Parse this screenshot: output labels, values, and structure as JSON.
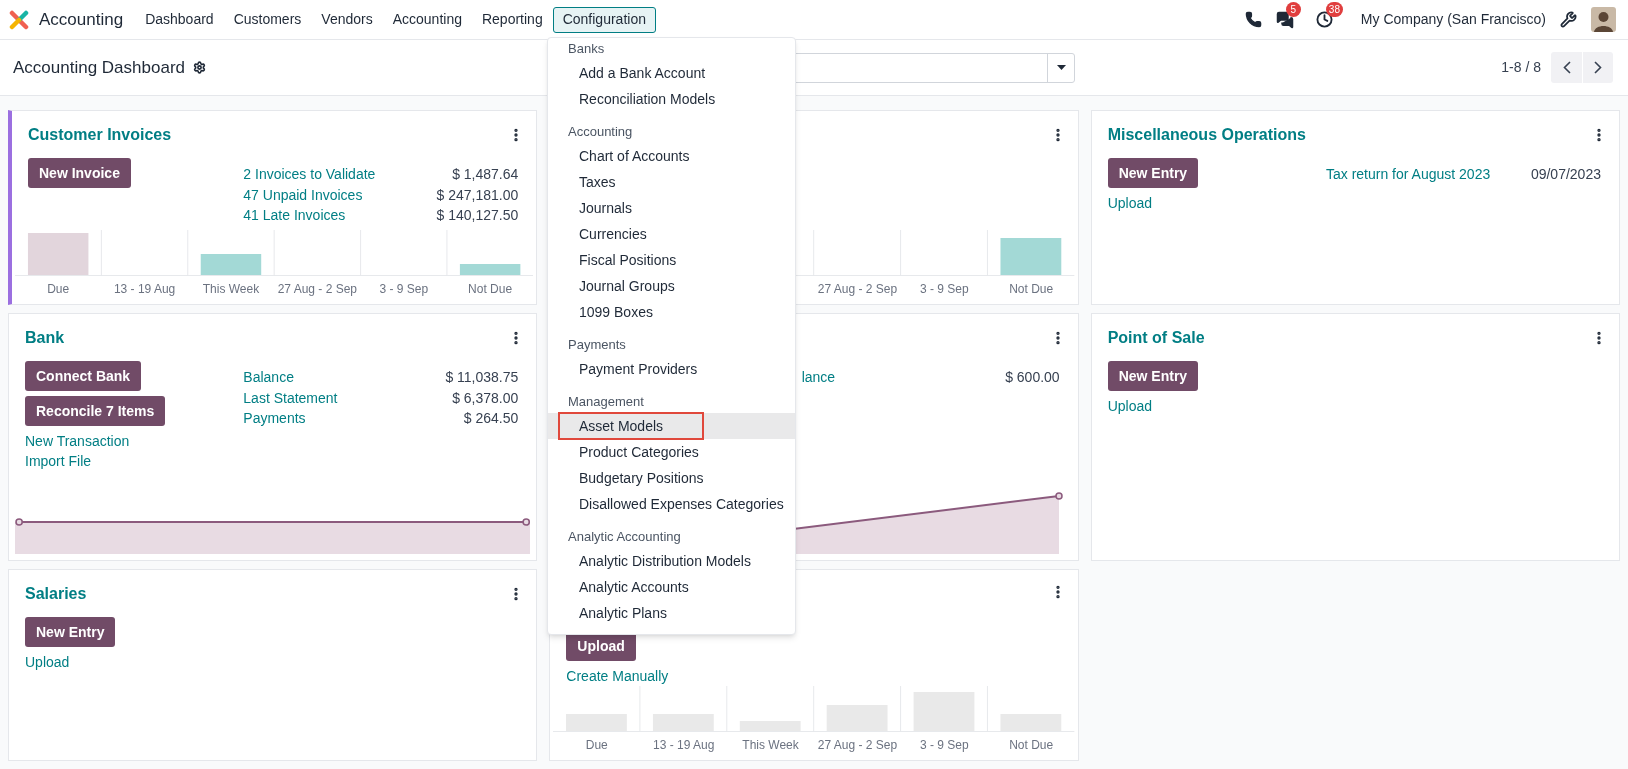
{
  "navbar": {
    "app_name": "Accounting",
    "menus": [
      {
        "label": "Dashboard",
        "selected": false
      },
      {
        "label": "Customers",
        "selected": false
      },
      {
        "label": "Vendors",
        "selected": false
      },
      {
        "label": "Accounting",
        "selected": false
      },
      {
        "label": "Reporting",
        "selected": false
      },
      {
        "label": "Configuration",
        "selected": true
      }
    ]
  },
  "systray": {
    "messages_badge": "5",
    "activities_badge": "38",
    "company": "My Company (San Francisco)"
  },
  "control_panel": {
    "title": "Accounting Dashboard",
    "pager": "1-8 / 8"
  },
  "configuration_menu": {
    "sections": [
      {
        "header": "Banks",
        "items": [
          {
            "label": "Add a Bank Account",
            "selected": false
          },
          {
            "label": "Reconciliation Models",
            "selected": false
          }
        ]
      },
      {
        "header": "Accounting",
        "items": [
          {
            "label": "Chart of Accounts",
            "selected": false
          },
          {
            "label": "Taxes",
            "selected": false
          },
          {
            "label": "Journals",
            "selected": false
          },
          {
            "label": "Currencies",
            "selected": false
          },
          {
            "label": "Fiscal Positions",
            "selected": false
          },
          {
            "label": "Journal Groups",
            "selected": false
          },
          {
            "label": "1099 Boxes",
            "selected": false
          }
        ]
      },
      {
        "header": "Payments",
        "items": [
          {
            "label": "Payment Providers",
            "selected": false
          }
        ]
      },
      {
        "header": "Management",
        "items": [
          {
            "label": "Asset Models",
            "selected": true
          },
          {
            "label": "Product Categories",
            "selected": false
          },
          {
            "label": "Budgetary Positions",
            "selected": false
          },
          {
            "label": "Disallowed Expenses Categories",
            "selected": false
          }
        ]
      },
      {
        "header": "Analytic Accounting",
        "items": [
          {
            "label": "Analytic Distribution Models",
            "selected": false
          },
          {
            "label": "Analytic Accounts",
            "selected": false
          },
          {
            "label": "Analytic Plans",
            "selected": false
          }
        ]
      }
    ]
  },
  "columns": [
    {
      "kind": "open",
      "cards": [
        {
          "title": "Customer Invoices",
          "color": "#9b6fe0",
          "buttons": [
            "New Invoice"
          ],
          "stats": [
            {
              "label": "2 Invoices to Validate",
              "value": "$ 1,487.64"
            },
            {
              "label": "47 Unpaid Invoices",
              "value": "$ 247,181.00"
            },
            {
              "label": "41 Late Invoices",
              "value": "$ 140,127.50"
            }
          ],
          "chart": {
            "kind": "invoices",
            "labels": [
              "Due",
              "13 - 19 Aug",
              "This Week",
              "27 Aug - 2 Sep",
              "3 - 9 Sep",
              "Not Due"
            ]
          }
        },
        {
          "title": "Bank",
          "buttons": [
            "Connect Bank",
            "Reconcile 7 Items"
          ],
          "links": [
            "New Transaction",
            "Import File"
          ],
          "stats": [
            {
              "label": "Balance",
              "value": "$ 11,038.75"
            },
            {
              "label": "Last Statement",
              "value": "$ 6,378.00"
            },
            {
              "label": "Payments",
              "value": "$ 264.50"
            }
          ],
          "chart": {
            "kind": "flat"
          }
        },
        {
          "title": "Salaries",
          "buttons": [
            "New Entry"
          ],
          "links": [
            "Upload"
          ]
        }
      ]
    },
    {
      "kind": "covered",
      "cards": [
        {
          "chart": {
            "kind": "partial",
            "labels": [
              "27 Aug - 2 Sep",
              "3 - 9 Sep",
              "Not Due"
            ]
          }
        },
        {
          "stats": [
            {
              "label": "lance",
              "value": "$ 600.00"
            }
          ],
          "chart": {
            "kind": "rising"
          }
        },
        {
          "buttons": [
            "Upload"
          ],
          "links": [
            "Create Manually"
          ],
          "chart": {
            "kind": "sample",
            "labels": [
              "Due",
              "13 - 19 Aug",
              "This Week",
              "27 Aug - 2 Sep",
              "3 - 9 Sep",
              "Not Due"
            ]
          }
        }
      ]
    },
    {
      "kind": "open",
      "cards": [
        {
          "title": "Miscellaneous Operations",
          "buttons": [
            "New Entry"
          ],
          "links": [
            "Upload"
          ],
          "stats": [
            {
              "label": "Tax return for August 2023",
              "value": "09/07/2023"
            }
          ]
        },
        {
          "title": "Point of Sale",
          "buttons": [
            "New Entry"
          ],
          "links": [
            "Upload"
          ]
        }
      ]
    }
  ]
}
